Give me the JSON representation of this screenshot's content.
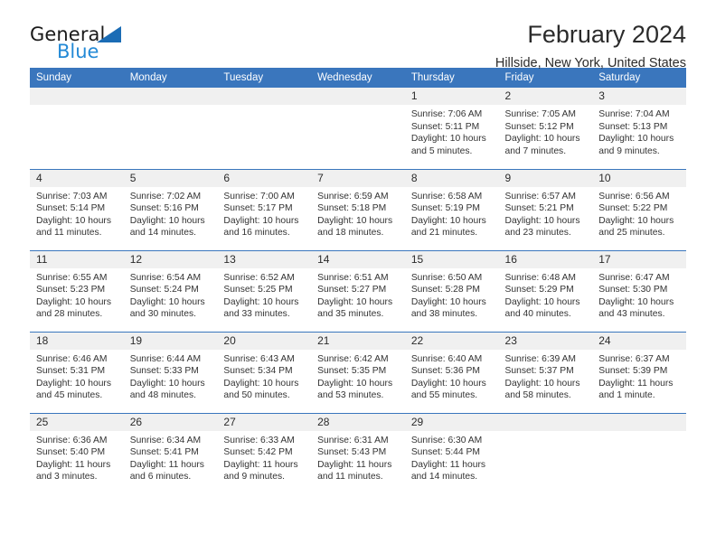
{
  "brand": {
    "name_part1": "General",
    "name_part2": "Blue",
    "triangle_color": "#1b6cb5",
    "blue_color": "#2389d6"
  },
  "header": {
    "title": "February 2024",
    "subtitle": "Hillside, New York, United States"
  },
  "theme": {
    "header_bg": "#3a76bd",
    "header_text": "#ffffff",
    "daynum_bg": "#f0f0f0",
    "rule_color": "#3a76bd"
  },
  "weekdays": [
    "Sunday",
    "Monday",
    "Tuesday",
    "Wednesday",
    "Thursday",
    "Friday",
    "Saturday"
  ],
  "labels": {
    "sunrise_prefix": "Sunrise:",
    "sunset_prefix": "Sunset:",
    "daylight_prefix": "Daylight:"
  },
  "weeks": [
    [
      {
        "empty": true
      },
      {
        "empty": true
      },
      {
        "empty": true
      },
      {
        "empty": true
      },
      {
        "day": "1",
        "sunrise": "Sunrise: 7:06 AM",
        "sunset": "Sunset: 5:11 PM",
        "daylight_line1": "Daylight: 10 hours",
        "daylight_line2": "and 5 minutes."
      },
      {
        "day": "2",
        "sunrise": "Sunrise: 7:05 AM",
        "sunset": "Sunset: 5:12 PM",
        "daylight_line1": "Daylight: 10 hours",
        "daylight_line2": "and 7 minutes."
      },
      {
        "day": "3",
        "sunrise": "Sunrise: 7:04 AM",
        "sunset": "Sunset: 5:13 PM",
        "daylight_line1": "Daylight: 10 hours",
        "daylight_line2": "and 9 minutes."
      }
    ],
    [
      {
        "day": "4",
        "sunrise": "Sunrise: 7:03 AM",
        "sunset": "Sunset: 5:14 PM",
        "daylight_line1": "Daylight: 10 hours",
        "daylight_line2": "and 11 minutes."
      },
      {
        "day": "5",
        "sunrise": "Sunrise: 7:02 AM",
        "sunset": "Sunset: 5:16 PM",
        "daylight_line1": "Daylight: 10 hours",
        "daylight_line2": "and 14 minutes."
      },
      {
        "day": "6",
        "sunrise": "Sunrise: 7:00 AM",
        "sunset": "Sunset: 5:17 PM",
        "daylight_line1": "Daylight: 10 hours",
        "daylight_line2": "and 16 minutes."
      },
      {
        "day": "7",
        "sunrise": "Sunrise: 6:59 AM",
        "sunset": "Sunset: 5:18 PM",
        "daylight_line1": "Daylight: 10 hours",
        "daylight_line2": "and 18 minutes."
      },
      {
        "day": "8",
        "sunrise": "Sunrise: 6:58 AM",
        "sunset": "Sunset: 5:19 PM",
        "daylight_line1": "Daylight: 10 hours",
        "daylight_line2": "and 21 minutes."
      },
      {
        "day": "9",
        "sunrise": "Sunrise: 6:57 AM",
        "sunset": "Sunset: 5:21 PM",
        "daylight_line1": "Daylight: 10 hours",
        "daylight_line2": "and 23 minutes."
      },
      {
        "day": "10",
        "sunrise": "Sunrise: 6:56 AM",
        "sunset": "Sunset: 5:22 PM",
        "daylight_line1": "Daylight: 10 hours",
        "daylight_line2": "and 25 minutes."
      }
    ],
    [
      {
        "day": "11",
        "sunrise": "Sunrise: 6:55 AM",
        "sunset": "Sunset: 5:23 PM",
        "daylight_line1": "Daylight: 10 hours",
        "daylight_line2": "and 28 minutes."
      },
      {
        "day": "12",
        "sunrise": "Sunrise: 6:54 AM",
        "sunset": "Sunset: 5:24 PM",
        "daylight_line1": "Daylight: 10 hours",
        "daylight_line2": "and 30 minutes."
      },
      {
        "day": "13",
        "sunrise": "Sunrise: 6:52 AM",
        "sunset": "Sunset: 5:25 PM",
        "daylight_line1": "Daylight: 10 hours",
        "daylight_line2": "and 33 minutes."
      },
      {
        "day": "14",
        "sunrise": "Sunrise: 6:51 AM",
        "sunset": "Sunset: 5:27 PM",
        "daylight_line1": "Daylight: 10 hours",
        "daylight_line2": "and 35 minutes."
      },
      {
        "day": "15",
        "sunrise": "Sunrise: 6:50 AM",
        "sunset": "Sunset: 5:28 PM",
        "daylight_line1": "Daylight: 10 hours",
        "daylight_line2": "and 38 minutes."
      },
      {
        "day": "16",
        "sunrise": "Sunrise: 6:48 AM",
        "sunset": "Sunset: 5:29 PM",
        "daylight_line1": "Daylight: 10 hours",
        "daylight_line2": "and 40 minutes."
      },
      {
        "day": "17",
        "sunrise": "Sunrise: 6:47 AM",
        "sunset": "Sunset: 5:30 PM",
        "daylight_line1": "Daylight: 10 hours",
        "daylight_line2": "and 43 minutes."
      }
    ],
    [
      {
        "day": "18",
        "sunrise": "Sunrise: 6:46 AM",
        "sunset": "Sunset: 5:31 PM",
        "daylight_line1": "Daylight: 10 hours",
        "daylight_line2": "and 45 minutes."
      },
      {
        "day": "19",
        "sunrise": "Sunrise: 6:44 AM",
        "sunset": "Sunset: 5:33 PM",
        "daylight_line1": "Daylight: 10 hours",
        "daylight_line2": "and 48 minutes."
      },
      {
        "day": "20",
        "sunrise": "Sunrise: 6:43 AM",
        "sunset": "Sunset: 5:34 PM",
        "daylight_line1": "Daylight: 10 hours",
        "daylight_line2": "and 50 minutes."
      },
      {
        "day": "21",
        "sunrise": "Sunrise: 6:42 AM",
        "sunset": "Sunset: 5:35 PM",
        "daylight_line1": "Daylight: 10 hours",
        "daylight_line2": "and 53 minutes."
      },
      {
        "day": "22",
        "sunrise": "Sunrise: 6:40 AM",
        "sunset": "Sunset: 5:36 PM",
        "daylight_line1": "Daylight: 10 hours",
        "daylight_line2": "and 55 minutes."
      },
      {
        "day": "23",
        "sunrise": "Sunrise: 6:39 AM",
        "sunset": "Sunset: 5:37 PM",
        "daylight_line1": "Daylight: 10 hours",
        "daylight_line2": "and 58 minutes."
      },
      {
        "day": "24",
        "sunrise": "Sunrise: 6:37 AM",
        "sunset": "Sunset: 5:39 PM",
        "daylight_line1": "Daylight: 11 hours",
        "daylight_line2": "and 1 minute."
      }
    ],
    [
      {
        "day": "25",
        "sunrise": "Sunrise: 6:36 AM",
        "sunset": "Sunset: 5:40 PM",
        "daylight_line1": "Daylight: 11 hours",
        "daylight_line2": "and 3 minutes."
      },
      {
        "day": "26",
        "sunrise": "Sunrise: 6:34 AM",
        "sunset": "Sunset: 5:41 PM",
        "daylight_line1": "Daylight: 11 hours",
        "daylight_line2": "and 6 minutes."
      },
      {
        "day": "27",
        "sunrise": "Sunrise: 6:33 AM",
        "sunset": "Sunset: 5:42 PM",
        "daylight_line1": "Daylight: 11 hours",
        "daylight_line2": "and 9 minutes."
      },
      {
        "day": "28",
        "sunrise": "Sunrise: 6:31 AM",
        "sunset": "Sunset: 5:43 PM",
        "daylight_line1": "Daylight: 11 hours",
        "daylight_line2": "and 11 minutes."
      },
      {
        "day": "29",
        "sunrise": "Sunrise: 6:30 AM",
        "sunset": "Sunset: 5:44 PM",
        "daylight_line1": "Daylight: 11 hours",
        "daylight_line2": "and 14 minutes."
      },
      {
        "empty": true
      },
      {
        "empty": true
      }
    ]
  ]
}
